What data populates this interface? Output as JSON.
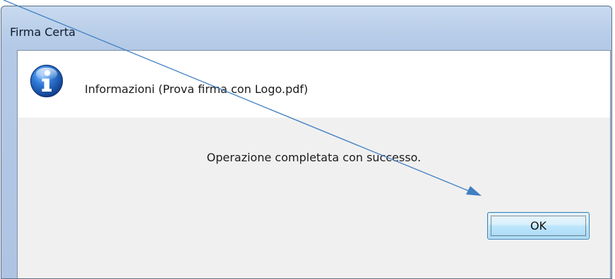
{
  "window": {
    "title": "Firma Certa"
  },
  "dialog": {
    "icon": "info-icon",
    "header_text": "Informazioni (Prova firma con Logo.pdf)",
    "message": "Operazione completata con successo.",
    "ok_label": "OK"
  },
  "annotation": {
    "icon": "arrow-annotation",
    "color": "#3f7fc2"
  },
  "colors": {
    "info_icon_blue": "#1f5fb4",
    "button_border": "#3c7fb1"
  }
}
